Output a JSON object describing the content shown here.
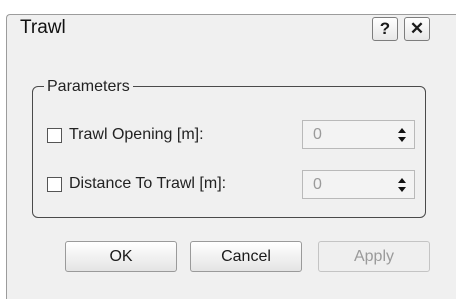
{
  "window": {
    "title": "Trawl",
    "help_label": "?",
    "close_label": "✕"
  },
  "parameters": {
    "group_label": "Parameters",
    "fields": [
      {
        "label": "Trawl Opening [m]:",
        "value": "0",
        "checked": false
      },
      {
        "label": "Distance To Trawl [m]:",
        "value": "0",
        "checked": false
      }
    ]
  },
  "buttons": {
    "ok": "OK",
    "cancel": "Cancel",
    "apply": "Apply"
  }
}
